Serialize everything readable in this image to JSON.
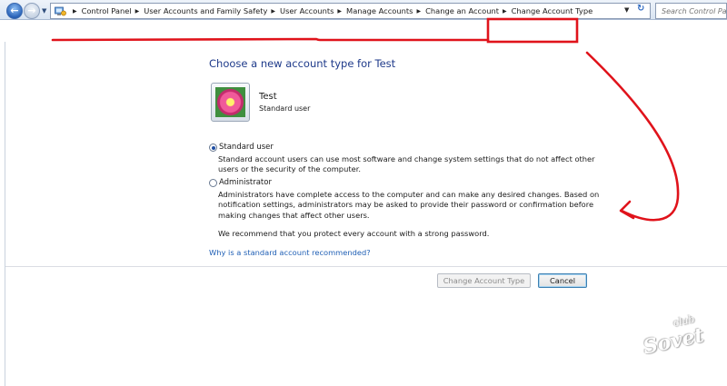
{
  "breadcrumbs": [
    "Control Panel",
    "User Accounts and Family Safety",
    "User Accounts",
    "Manage Accounts",
    "Change an Account",
    "Change Account Type"
  ],
  "search": {
    "placeholder": "Search Control Panel"
  },
  "main": {
    "heading": "Choose a new account type for Test",
    "user": {
      "name": "Test",
      "type": "Standard user"
    },
    "options": [
      {
        "label": "Standard user",
        "selected": true,
        "description": "Standard account users can use most software and change system settings that do not affect other users or the security of the computer."
      },
      {
        "label": "Administrator",
        "selected": false,
        "description": "Administrators have complete access to the computer and can make any desired changes. Based on notification settings, administrators may be asked to provide their password or confirmation before making changes that affect other users."
      }
    ],
    "recommendation": "We recommend that you protect every account with a strong password.",
    "help_link": "Why is a standard account recommended?"
  },
  "buttons": {
    "change": "Change Account Type",
    "cancel": "Cancel"
  },
  "watermark": {
    "line1": "club",
    "line2": "Sovet"
  },
  "colors": {
    "annotation": "#e0131b",
    "link": "#1f5fb5",
    "heading": "#1e3a8a"
  },
  "icons": [
    "back-arrow-icon",
    "forward-arrow-icon",
    "control-panel-icon",
    "dropdown-arrow-icon",
    "refresh-icon"
  ]
}
